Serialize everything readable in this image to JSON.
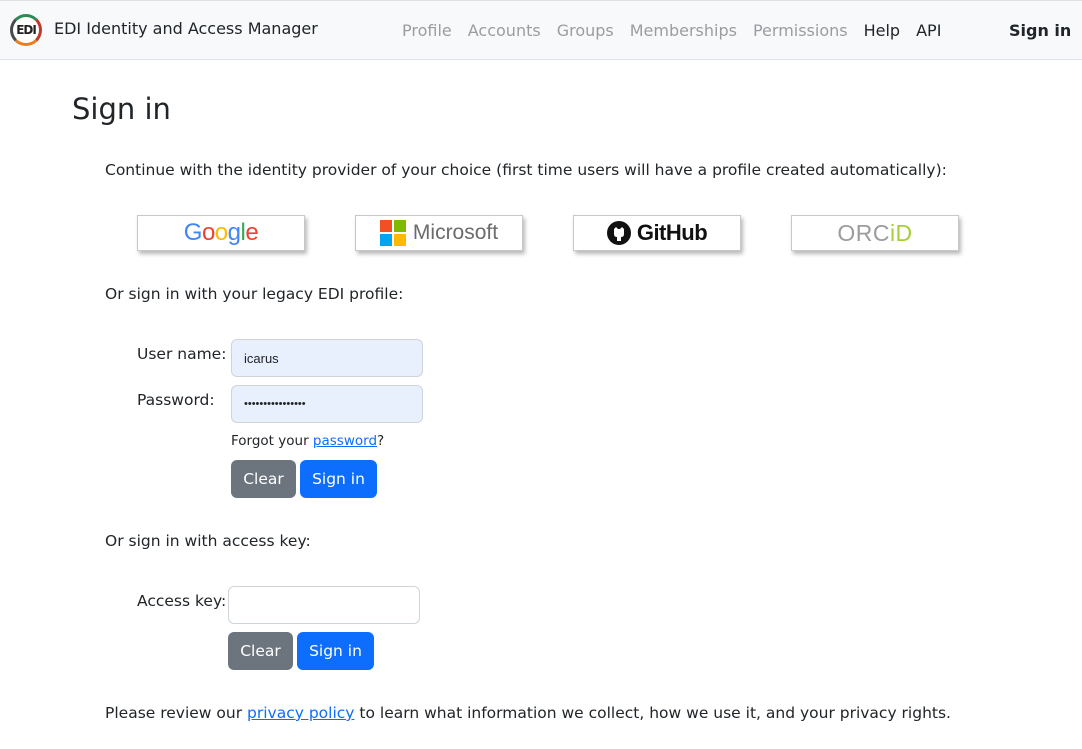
{
  "navbar": {
    "logo_text": "EDI",
    "brand": "EDI Identity and Access Manager",
    "links": [
      {
        "label": "Profile",
        "state": "disabled"
      },
      {
        "label": "Accounts",
        "state": "disabled"
      },
      {
        "label": "Groups",
        "state": "disabled"
      },
      {
        "label": "Memberships",
        "state": "disabled"
      },
      {
        "label": "Permissions",
        "state": "disabled"
      },
      {
        "label": "Help",
        "state": "active"
      },
      {
        "label": "API",
        "state": "active"
      }
    ],
    "signin": "Sign in"
  },
  "page": {
    "title": "Sign in",
    "intro": "Continue with the identity provider of your choice (first time users will have a profile created automatically):"
  },
  "providers": {
    "google": "Google",
    "microsoft": "Microsoft",
    "github": "GitHub",
    "orcid_prefix": "ORC",
    "orcid_suffix": "iD"
  },
  "legacy": {
    "heading": "Or sign in with your legacy EDI profile:",
    "username_label": "User name:",
    "username_value": "icarus",
    "password_label": "Password:",
    "password_value": "••••••••••••••••",
    "forgot_prefix": "Forgot your ",
    "forgot_link": "password",
    "forgot_suffix": "?",
    "clear": "Clear",
    "signin": "Sign in"
  },
  "access_key": {
    "heading": "Or sign in with access key:",
    "label": "Access key:",
    "value": "",
    "clear": "Clear",
    "signin": "Sign in"
  },
  "privacy": {
    "prefix": "Please review our ",
    "link": "privacy policy",
    "suffix": " to learn what information we collect, how we use it, and your privacy rights."
  },
  "colors": {
    "primary": "#0d6efd",
    "secondary": "#6c757d",
    "autofill": "#e8f0fe",
    "google_blue": "#4285F4",
    "google_red": "#EA4335",
    "google_yellow": "#FBBC05",
    "google_green": "#34A853",
    "ms_red": "#F25022",
    "ms_green": "#7FBA00",
    "ms_blue": "#00A4EF",
    "ms_yellow": "#FFB900",
    "orcid_green": "#A6CE39"
  }
}
